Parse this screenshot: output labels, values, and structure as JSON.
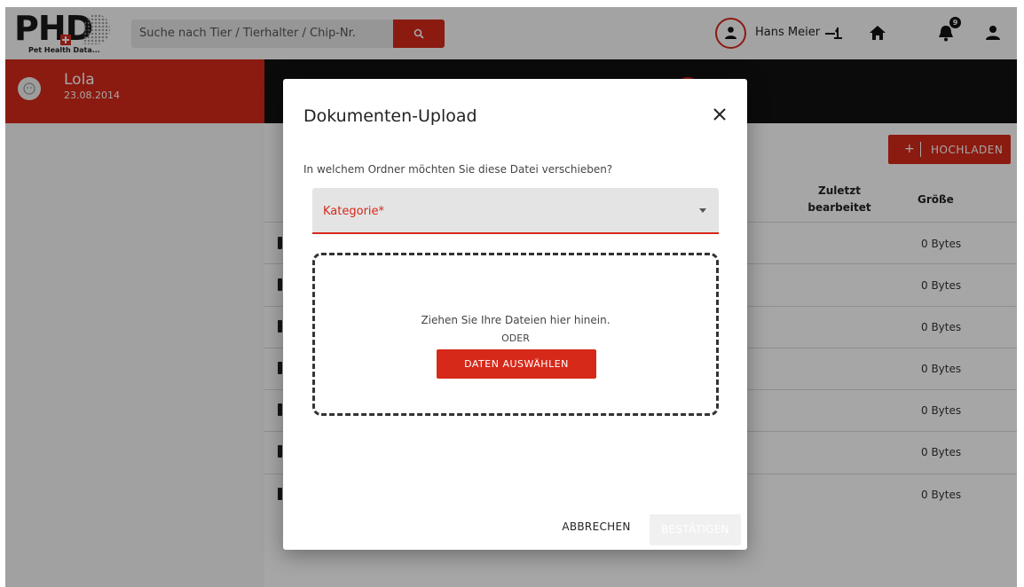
{
  "app": {
    "logo_text": "PHD",
    "logo_subtitle": "Pet Health Data..."
  },
  "topbar": {
    "search_placeholder": "Suche nach Tier / Tierhalter / Chip-Nr.",
    "user_name": "Hans Meier",
    "notification_count": "9"
  },
  "pet": {
    "name": "Lola",
    "birthdate": "23.08.2014"
  },
  "documents": {
    "upload_label": "HOCHLADEN",
    "upload_plus": "+",
    "columns": {
      "last_edited": "Zuletzt bearbeitet",
      "size": "Größe"
    },
    "rows": [
      {
        "size": "0 Bytes"
      },
      {
        "size": "0 Bytes"
      },
      {
        "size": "0 Bytes"
      },
      {
        "size": "0 Bytes"
      },
      {
        "size": "0 Bytes"
      },
      {
        "size": "0 Bytes"
      },
      {
        "size": "0 Bytes"
      }
    ]
  },
  "modal": {
    "title": "Dokumenten-Upload",
    "question": "In welchem Ordner möchten Sie diese Datei verschieben?",
    "category_placeholder": "Kategorie*",
    "dropzone_text": "Ziehen Sie Ihre Dateien hier hinein.",
    "dropzone_or": "ODER",
    "choose_button": "DATEN AUSWÄHLEN",
    "cancel_button": "ABBRECHEN",
    "confirm_button": "BESTÄTIGEN"
  },
  "colors": {
    "accent": "#d6291a",
    "header_dark": "#111111"
  }
}
